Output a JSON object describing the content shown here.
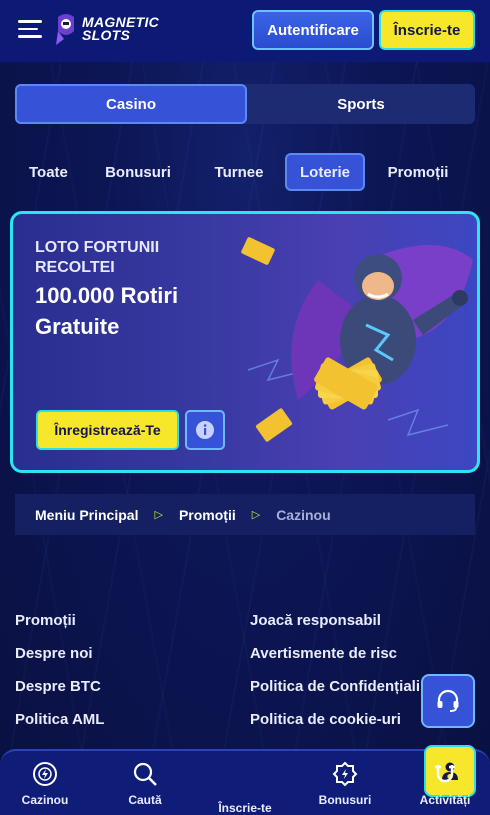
{
  "header": {
    "logo_line1": "MAGNETIC",
    "logo_line2": "SLOTS",
    "login_label": "Autentificare",
    "signup_label": "Înscrie-te"
  },
  "switch": {
    "tabs": [
      {
        "label": "Casino",
        "active": true
      },
      {
        "label": "Sports",
        "active": false
      }
    ]
  },
  "categories": [
    {
      "label": "Toate",
      "active": false
    },
    {
      "label": "Bonusuri",
      "active": false
    },
    {
      "label": "Turnee",
      "active": false
    },
    {
      "label": "Loterie",
      "active": true
    },
    {
      "label": "Promoții",
      "active": false
    }
  ],
  "banner": {
    "title": "LOTO FORTUNII RECOLTEI",
    "prize": "100.000 Rotiri Gratuite",
    "cta_label": "Înregistrează-Te",
    "info_icon": "info-icon"
  },
  "breadcrumb": {
    "items": [
      "Meniu Principal",
      "Promoții",
      "Cazinou"
    ]
  },
  "footer_links": {
    "left": [
      "Promoții",
      "Despre noi",
      "Despre BTC",
      "Politica AML"
    ],
    "right": [
      "Joacă responsabil",
      "Avertismente de risc",
      "Politica de Confidențialitate",
      "Politica de cookie-uri"
    ]
  },
  "bottom_nav": [
    {
      "label": "Cazinou",
      "icon": "casino-chip-icon"
    },
    {
      "label": "Caută",
      "icon": "search-icon"
    },
    {
      "label": "Înscrie-te",
      "icon": "user-plus-icon"
    },
    {
      "label": "Bonusuri",
      "icon": "bonus-badge-icon"
    },
    {
      "label": "Activități",
      "icon": "magnet-icon"
    }
  ],
  "colors": {
    "accent_yellow": "#f6e72a",
    "accent_cyan": "#2ae0e6",
    "primary_blue": "#3652d6",
    "background": "#0c1654"
  }
}
